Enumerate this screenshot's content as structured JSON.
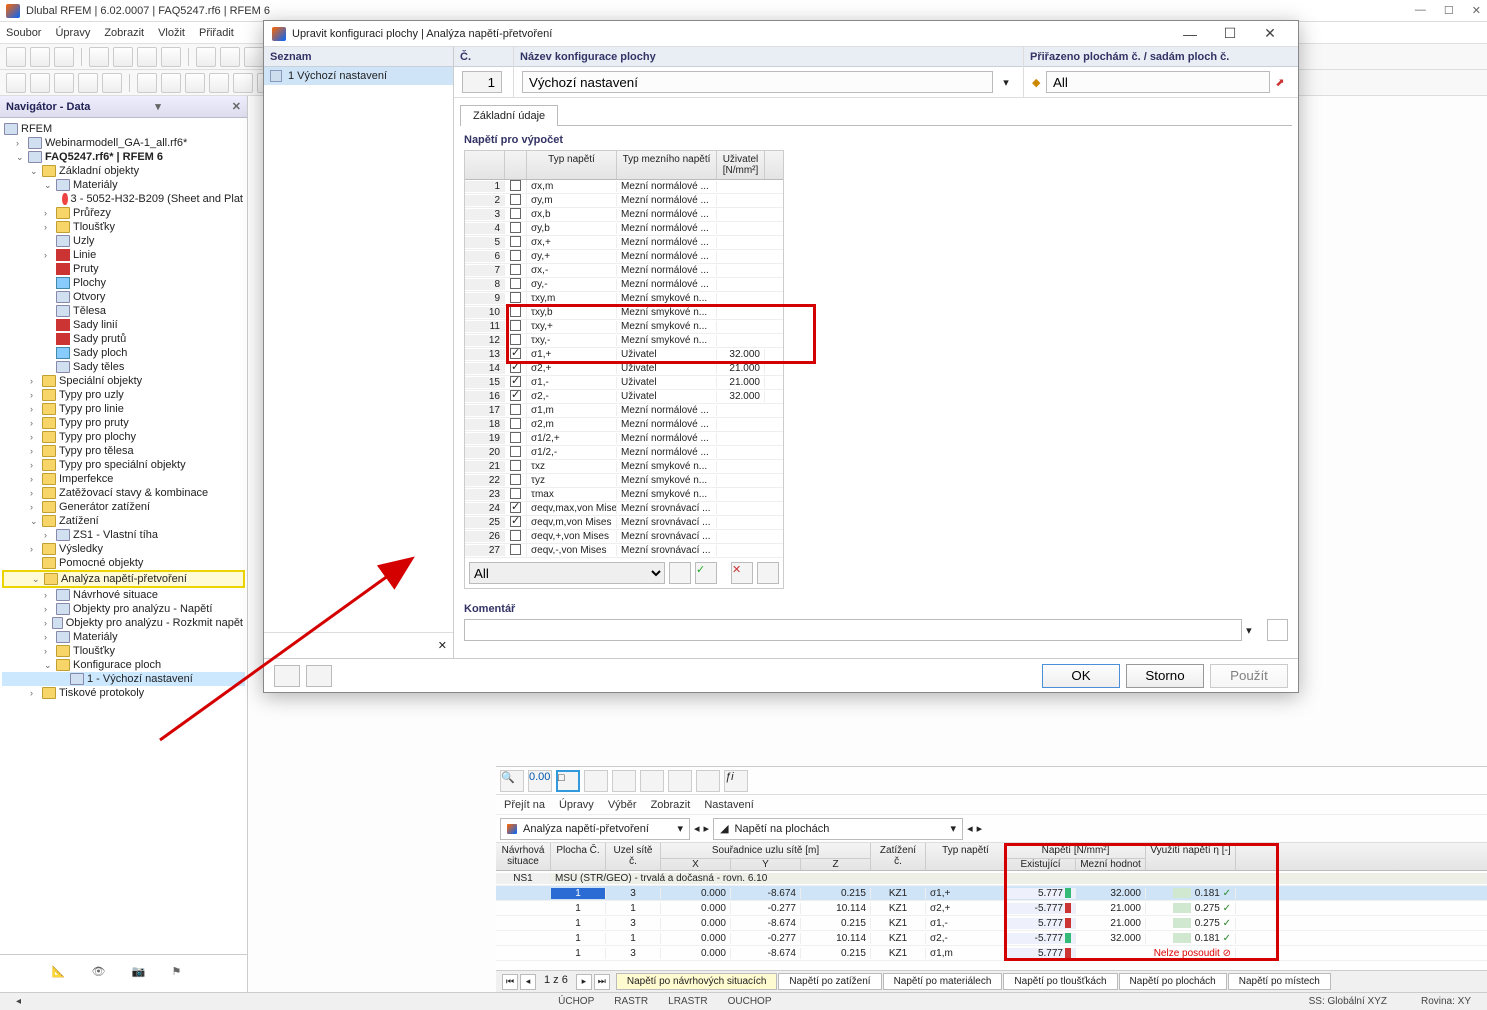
{
  "app": {
    "title": "Dlubal RFEM | 6.02.0007 | FAQ5247.rf6 | RFEM 6"
  },
  "menubar": [
    "Soubor",
    "Úpravy",
    "Zobrazit",
    "Vložit",
    "Přiřadit"
  ],
  "nav": {
    "header": "Navigátor - Data",
    "root": "RFEM",
    "items": [
      {
        "label": "Webinarmodell_GA-1_all.rf6*",
        "indent": 1,
        "icon": "file",
        "arrow": "›"
      },
      {
        "label": "FAQ5247.rf6* | RFEM 6",
        "indent": 1,
        "icon": "file",
        "arrow": "⌄",
        "bold": true
      },
      {
        "label": "Základní objekty",
        "indent": 2,
        "icon": "folder",
        "arrow": "⌄"
      },
      {
        "label": "Materiály",
        "indent": 3,
        "icon": "mat",
        "arrow": "⌄"
      },
      {
        "label": "3 - 5052-H32-B209 (Sheet and Plat",
        "indent": 4,
        "icon": "dot"
      },
      {
        "label": "Průřezy",
        "indent": 3,
        "icon": "folder",
        "arrow": "›"
      },
      {
        "label": "Tloušťky",
        "indent": 3,
        "icon": "folder",
        "arrow": "›"
      },
      {
        "label": "Uzly",
        "indent": 3,
        "icon": "node"
      },
      {
        "label": "Linie",
        "indent": 3,
        "icon": "line",
        "arrow": "›"
      },
      {
        "label": "Pruty",
        "indent": 3,
        "icon": "line"
      },
      {
        "label": "Plochy",
        "indent": 3,
        "icon": "surf"
      },
      {
        "label": "Otvory",
        "indent": 3,
        "icon": "open"
      },
      {
        "label": "Tělesa",
        "indent": 3,
        "icon": "solid"
      },
      {
        "label": "Sady linií",
        "indent": 3,
        "icon": "line"
      },
      {
        "label": "Sady prutů",
        "indent": 3,
        "icon": "line"
      },
      {
        "label": "Sady ploch",
        "indent": 3,
        "icon": "surf"
      },
      {
        "label": "Sady těles",
        "indent": 3,
        "icon": "solid"
      },
      {
        "label": "Speciální objekty",
        "indent": 2,
        "icon": "folder",
        "arrow": "›"
      },
      {
        "label": "Typy pro uzly",
        "indent": 2,
        "icon": "folder",
        "arrow": "›"
      },
      {
        "label": "Typy pro linie",
        "indent": 2,
        "icon": "folder",
        "arrow": "›"
      },
      {
        "label": "Typy pro pruty",
        "indent": 2,
        "icon": "folder",
        "arrow": "›"
      },
      {
        "label": "Typy pro plochy",
        "indent": 2,
        "icon": "folder",
        "arrow": "›"
      },
      {
        "label": "Typy pro tělesa",
        "indent": 2,
        "icon": "folder",
        "arrow": "›"
      },
      {
        "label": "Typy pro speciální objekty",
        "indent": 2,
        "icon": "folder",
        "arrow": "›"
      },
      {
        "label": "Imperfekce",
        "indent": 2,
        "icon": "folder",
        "arrow": "›"
      },
      {
        "label": "Zatěžovací stavy & kombinace",
        "indent": 2,
        "icon": "folder",
        "arrow": "›"
      },
      {
        "label": "Generátor zatížení",
        "indent": 2,
        "icon": "folder",
        "arrow": "›"
      },
      {
        "label": "Zatížení",
        "indent": 2,
        "icon": "folder",
        "arrow": "⌄"
      },
      {
        "label": "ZS1 - Vlastní tíha",
        "indent": 3,
        "icon": "load",
        "arrow": "›"
      },
      {
        "label": "Výsledky",
        "indent": 2,
        "icon": "folder",
        "arrow": "›"
      },
      {
        "label": "Pomocné objekty",
        "indent": 2,
        "icon": "folder"
      },
      {
        "label": "Analýza napětí-přetvoření",
        "indent": 2,
        "icon": "folder",
        "arrow": "⌄",
        "hl": true
      },
      {
        "label": "Návrhové situace",
        "indent": 3,
        "icon": "chart",
        "arrow": "›"
      },
      {
        "label": "Objekty pro analýzu - Napětí",
        "indent": 3,
        "icon": "chart",
        "arrow": "›"
      },
      {
        "label": "Objekty pro analýzu - Rozkmit napět",
        "indent": 3,
        "icon": "chart",
        "arrow": "›"
      },
      {
        "label": "Materiály",
        "indent": 3,
        "icon": "mat",
        "arrow": "›"
      },
      {
        "label": "Tloušťky",
        "indent": 3,
        "icon": "folder",
        "arrow": "›"
      },
      {
        "label": "Konfigurace ploch",
        "indent": 3,
        "icon": "folder",
        "arrow": "⌄"
      },
      {
        "label": "1 - Výchozí nastavení",
        "indent": 4,
        "icon": "item",
        "sel": true
      },
      {
        "label": "Tiskové protokoly",
        "indent": 2,
        "icon": "folder",
        "arrow": "›"
      }
    ]
  },
  "dialog": {
    "title": "Upravit konfiguraci plochy | Analýza napětí-přetvoření",
    "list_header": "Seznam",
    "list_item": "1  Výchozí nastavení",
    "c_header": "Č.",
    "c_value": "1",
    "name_header": "Název konfigurace plochy",
    "name_value": "Výchozí nastavení",
    "assign_header": "Přiřazeno plochám č. / sadám ploch č.",
    "assign_value": "All",
    "tab": "Základní údaje",
    "section": "Napětí pro výpočet",
    "grid_headers": {
      "type": "Typ\nnapětí",
      "limit": "Typ mezního\nnapětí",
      "user": "Uživatel\n[N/mm²]"
    },
    "rows": [
      {
        "n": 1,
        "chk": false,
        "t": "σx,m",
        "lim": "Mezní normálové ...",
        "u": ""
      },
      {
        "n": 2,
        "chk": false,
        "t": "σy,m",
        "lim": "Mezní normálové ...",
        "u": ""
      },
      {
        "n": 3,
        "chk": false,
        "t": "σx,b",
        "lim": "Mezní normálové ...",
        "u": ""
      },
      {
        "n": 4,
        "chk": false,
        "t": "σy,b",
        "lim": "Mezní normálové ...",
        "u": ""
      },
      {
        "n": 5,
        "chk": false,
        "t": "σx,+",
        "lim": "Mezní normálové ...",
        "u": ""
      },
      {
        "n": 6,
        "chk": false,
        "t": "σy,+",
        "lim": "Mezní normálové ...",
        "u": ""
      },
      {
        "n": 7,
        "chk": false,
        "t": "σx,-",
        "lim": "Mezní normálové ...",
        "u": ""
      },
      {
        "n": 8,
        "chk": false,
        "t": "σy,-",
        "lim": "Mezní normálové ...",
        "u": ""
      },
      {
        "n": 9,
        "chk": false,
        "t": "τxy,m",
        "lim": "Mezní smykové n...",
        "u": ""
      },
      {
        "n": 10,
        "chk": false,
        "t": "τxy,b",
        "lim": "Mezní smykové n...",
        "u": ""
      },
      {
        "n": 11,
        "chk": false,
        "t": "τxy,+",
        "lim": "Mezní smykové n...",
        "u": ""
      },
      {
        "n": 12,
        "chk": false,
        "t": "τxy,-",
        "lim": "Mezní smykové n...",
        "u": ""
      },
      {
        "n": 13,
        "chk": true,
        "t": "σ1,+",
        "lim": "Uživatel",
        "u": "32.000",
        "hl": true
      },
      {
        "n": 14,
        "chk": true,
        "t": "σ2,+",
        "lim": "Uživatel",
        "u": "21.000",
        "hl": true
      },
      {
        "n": 15,
        "chk": true,
        "t": "σ1,-",
        "lim": "Uživatel",
        "u": "21.000",
        "hl": true
      },
      {
        "n": 16,
        "chk": true,
        "t": "σ2,-",
        "lim": "Uživatel",
        "u": "32.000",
        "hl": true
      },
      {
        "n": 17,
        "chk": false,
        "t": "σ1,m",
        "lim": "Mezní normálové ...",
        "u": ""
      },
      {
        "n": 18,
        "chk": false,
        "t": "σ2,m",
        "lim": "Mezní normálové ...",
        "u": ""
      },
      {
        "n": 19,
        "chk": false,
        "t": "σ1/2,+",
        "lim": "Mezní normálové ...",
        "u": ""
      },
      {
        "n": 20,
        "chk": false,
        "t": "σ1/2,-",
        "lim": "Mezní normálové ...",
        "u": ""
      },
      {
        "n": 21,
        "chk": false,
        "t": "τxz",
        "lim": "Mezní smykové n...",
        "u": ""
      },
      {
        "n": 22,
        "chk": false,
        "t": "τyz",
        "lim": "Mezní smykové n...",
        "u": ""
      },
      {
        "n": 23,
        "chk": false,
        "t": "τmax",
        "lim": "Mezní smykové n...",
        "u": ""
      },
      {
        "n": 24,
        "chk": true,
        "t": "σeqv,max,von Mises",
        "lim": "Mezní srovnávací ...",
        "u": ""
      },
      {
        "n": 25,
        "chk": true,
        "t": "σeqv,m,von Mises",
        "lim": "Mezní srovnávací ...",
        "u": ""
      },
      {
        "n": 26,
        "chk": false,
        "t": "σeqv,+,von Mises",
        "lim": "Mezní srovnávací ...",
        "u": ""
      },
      {
        "n": 27,
        "chk": false,
        "t": "σeqv,-,von Mises",
        "lim": "Mezní srovnávací ...",
        "u": ""
      }
    ],
    "filter": "All",
    "comment_label": "Komentář",
    "btn_ok": "OK",
    "btn_cancel": "Storno",
    "btn_apply": "Použít"
  },
  "results": {
    "menubar": [
      "Přejít na",
      "Úpravy",
      "Výběr",
      "Zobrazit",
      "Nastavení"
    ],
    "combo1": "Analýza napětí-přetvoření",
    "combo2": "Napětí na plochách",
    "headers": [
      "Návrhová\nsituace",
      "Plocha\nČ.",
      "Uzel\nsítě č.",
      "X",
      "Y",
      "Z",
      "Zatížení\nč.",
      "Typ\nnapětí",
      "Existující",
      "Mezní hodnot",
      "Využití\nnapětí η [-]"
    ],
    "coord_header": "Souřadnice uzlu sítě [m]",
    "stress_header": "Napětí [N/mm²]",
    "group_row": {
      "sit": "NS1",
      "text": "MSÚ (STR/GEO) - trvalá a dočasná - rovn. 6.10"
    },
    "rows": [
      {
        "pl": "1",
        "uzl": "3",
        "x": "0.000",
        "y": "-8.674",
        "z": "0.215",
        "lz": "KZ1",
        "typ": "σ1,+",
        "ex": "5.777",
        "mz": "32.000",
        "vy": "0.181",
        "ok": true,
        "sel": true,
        "bar": "#3b7"
      },
      {
        "pl": "1",
        "uzl": "1",
        "x": "0.000",
        "y": "-0.277",
        "z": "10.114",
        "lz": "KZ1",
        "typ": "σ2,+",
        "ex": "-5.777",
        "mz": "21.000",
        "vy": "0.275",
        "ok": true,
        "bar": "#c33"
      },
      {
        "pl": "1",
        "uzl": "3",
        "x": "0.000",
        "y": "-8.674",
        "z": "0.215",
        "lz": "KZ1",
        "typ": "σ1,-",
        "ex": "5.777",
        "mz": "21.000",
        "vy": "0.275",
        "ok": true,
        "bar": "#c33"
      },
      {
        "pl": "1",
        "uzl": "1",
        "x": "0.000",
        "y": "-0.277",
        "z": "10.114",
        "lz": "KZ1",
        "typ": "σ2,-",
        "ex": "-5.777",
        "mz": "32.000",
        "vy": "0.181",
        "ok": true,
        "bar": "#3b7"
      },
      {
        "pl": "1",
        "uzl": "3",
        "x": "0.000",
        "y": "-8.674",
        "z": "0.215",
        "lz": "KZ1",
        "typ": "σ1,m",
        "ex": "5.777",
        "mz": "",
        "vy": "Nelze posoudit",
        "ok": false,
        "bar": "#c33"
      }
    ],
    "pager": "1 z 6",
    "tabs": [
      "Napětí po návrhových situacích",
      "Napětí po zatížení",
      "Napětí po materiálech",
      "Napětí po tloušťkách",
      "Napětí po plochách",
      "Napětí po místech"
    ]
  },
  "statusbar": {
    "snaps": [
      "ÚCHOP",
      "RASTR",
      "LRASTR",
      "OUCHOP"
    ],
    "cs": "SS: Globální XYZ",
    "plane": "Rovina: XY"
  }
}
